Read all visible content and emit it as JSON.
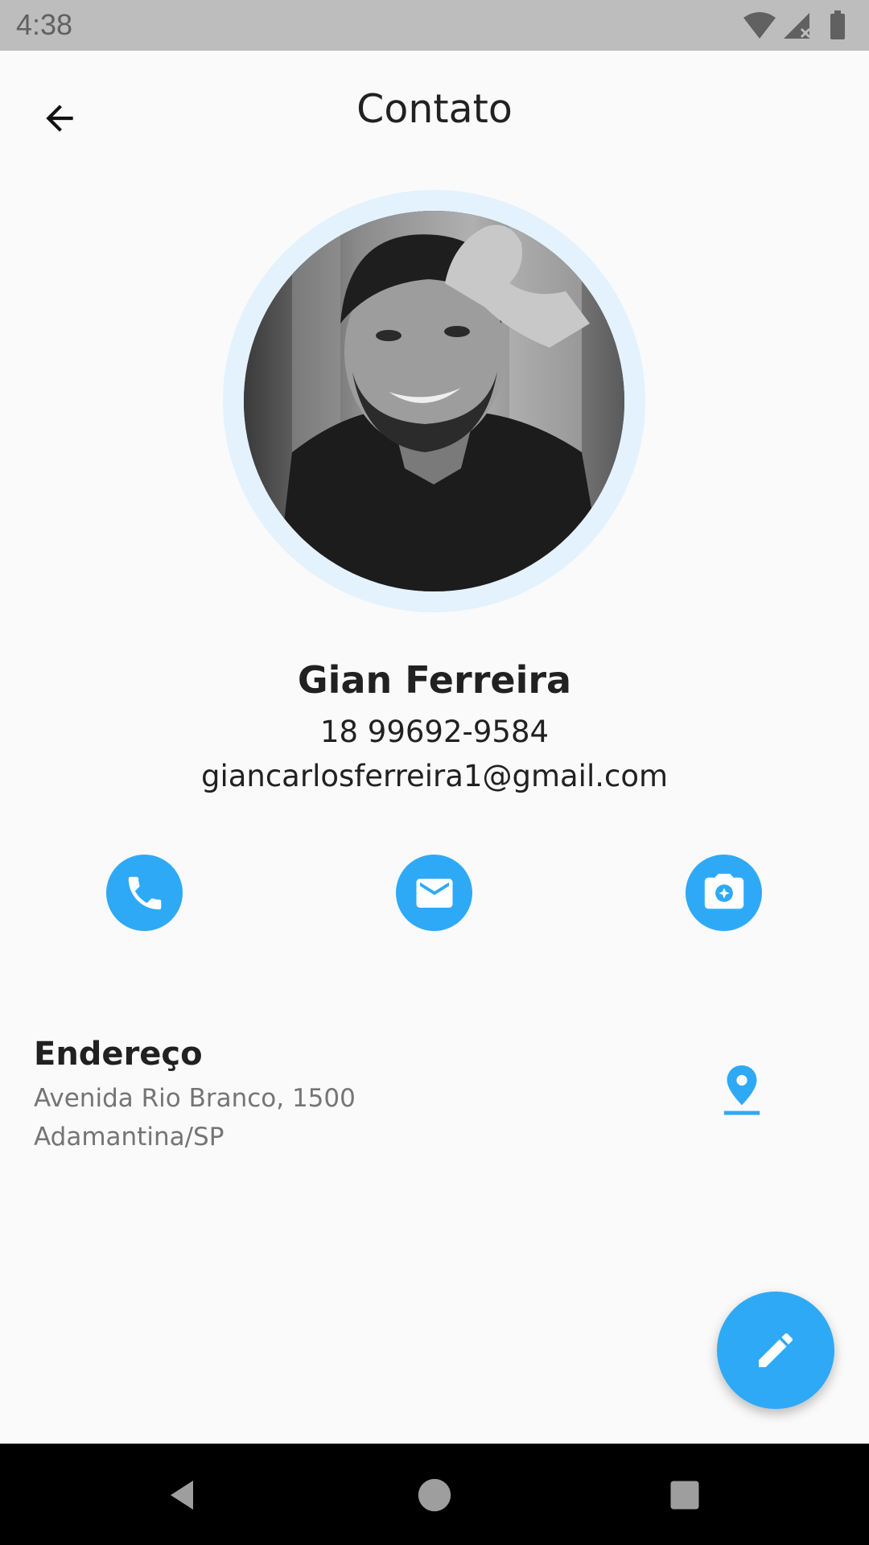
{
  "status_bar": {
    "time": "4:38",
    "icons": [
      "wifi-icon",
      "signal-icon",
      "battery-icon"
    ]
  },
  "app_bar": {
    "title": "Contato",
    "back_icon": "arrow-back-icon"
  },
  "contact": {
    "name": "Gian Ferreira",
    "phone": "18 99692-9584",
    "email": "giancarlosferreira1@gmail.com"
  },
  "actions": [
    {
      "icon": "phone-icon"
    },
    {
      "icon": "mail-icon"
    },
    {
      "icon": "camera-icon"
    }
  ],
  "address": {
    "title": "Endereço",
    "line1": "Avenida Rio Branco, 1500",
    "line2": "Adamantina/SP",
    "icon": "location-pin-icon"
  },
  "fab": {
    "icon": "edit-pencil-icon"
  },
  "nav_bar": {
    "buttons": [
      "back-triangle-icon",
      "home-circle-icon",
      "recents-square-icon"
    ]
  },
  "colors": {
    "accent": "#2ea9f6",
    "avatar_ring": "#e3f2fd",
    "background": "#fafafa",
    "status_bar": "#bdbdbd"
  }
}
